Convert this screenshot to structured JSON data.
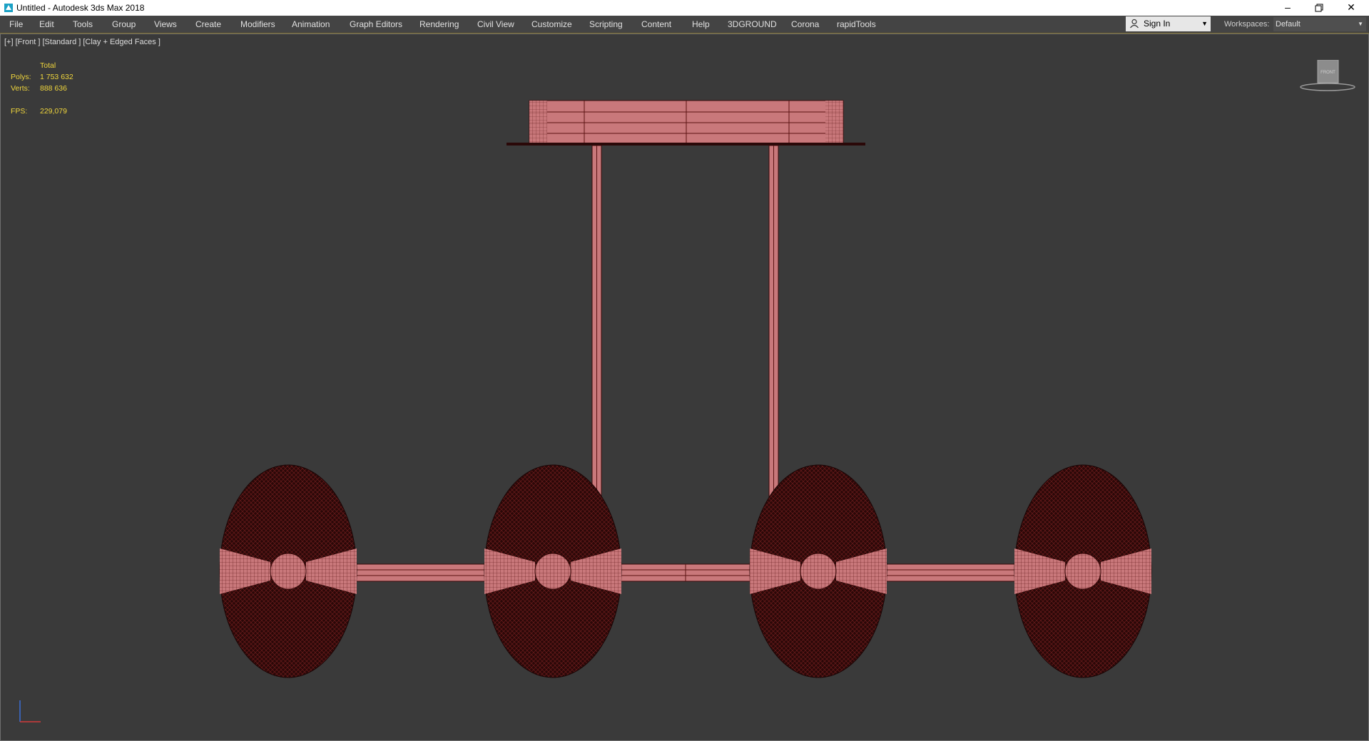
{
  "window": {
    "title": "Untitled - Autodesk 3ds Max 2018",
    "controls": [
      "minimize-icon",
      "restore-icon",
      "close-icon"
    ]
  },
  "menu": {
    "items": [
      "File",
      "Edit",
      "Tools",
      "Group",
      "Views",
      "Create",
      "Modifiers",
      "Animation",
      "Graph Editors",
      "Rendering",
      "Civil View",
      "Customize",
      "Scripting",
      "Content",
      "Help",
      "3DGROUND",
      "Corona",
      "rapidTools"
    ]
  },
  "account": {
    "sign_in": "Sign In"
  },
  "workspaces": {
    "label": "Workspaces:",
    "value": "Default"
  },
  "viewport": {
    "label": "[+] [Front ] [Standard ] [Clay + Edged Faces ]",
    "stats": {
      "header": "Total",
      "polys_label": "Polys:",
      "polys_value": "1 753 632",
      "verts_label": "Verts:",
      "verts_value": "888 636",
      "fps_label": "FPS:",
      "fps_value": "229,079"
    },
    "viewcube_face": "FRONT",
    "colors": {
      "background": "#3a3a3a",
      "mesh_fill": "#c9787b",
      "mesh_dark": "#2a0808",
      "wire": "#5a1212",
      "stats_text": "#f0d63c"
    }
  }
}
